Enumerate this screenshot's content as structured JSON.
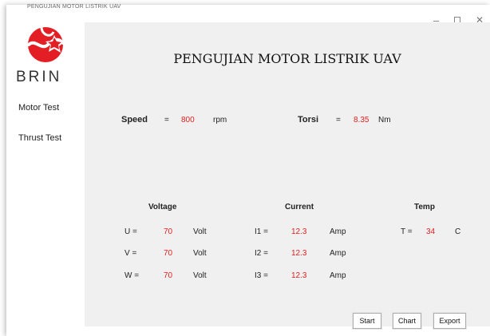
{
  "window": {
    "title": "PENGUJIAN MOTOR LISTRIK UAV",
    "controls": {
      "minimize": "–",
      "maximize": "",
      "close": "✕"
    }
  },
  "sidebar": {
    "brand": "BRIN",
    "items": [
      {
        "label": "Motor Test"
      },
      {
        "label": "Thrust Test"
      }
    ]
  },
  "main": {
    "title": "PENGUJIAN MOTOR LISTRIK UAV",
    "speed": {
      "label": "Speed",
      "eq": "=",
      "value": "800",
      "unit": "rpm"
    },
    "torsi": {
      "label": "Torsi",
      "eq": "=",
      "value": "8.35",
      "unit": "Nm"
    },
    "voltage": {
      "header": "Voltage",
      "rows": [
        {
          "label": "U =",
          "value": "70",
          "unit": "Volt"
        },
        {
          "label": "V =",
          "value": "70",
          "unit": "Volt"
        },
        {
          "label": "W =",
          "value": "70",
          "unit": "Volt"
        }
      ]
    },
    "current": {
      "header": "Current",
      "rows": [
        {
          "label": "I1 =",
          "value": "12.3",
          "unit": "Amp"
        },
        {
          "label": "I2 =",
          "value": "12.3",
          "unit": "Amp"
        },
        {
          "label": "I3 =",
          "value": "12.3",
          "unit": "Amp"
        }
      ]
    },
    "temp": {
      "header": "Temp",
      "label": "T =",
      "value": "34",
      "unit": "C"
    },
    "buttons": {
      "start": "Start",
      "chart": "Chart",
      "export": "Export"
    }
  },
  "colors": {
    "value": "#e02020",
    "panel": "#f0f0f0",
    "logo_red": "#e31e24"
  }
}
